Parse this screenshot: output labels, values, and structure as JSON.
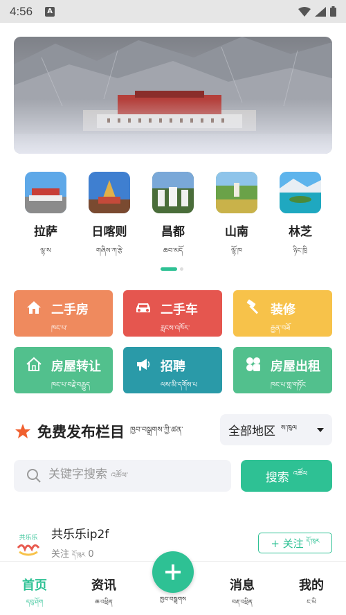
{
  "status_bar": {
    "time": "4:56",
    "notif_letter": "A"
  },
  "banner": {
    "subject": "Potala Palace"
  },
  "cities": [
    {
      "name": "拉萨",
      "tib": "ལྷ་ས"
    },
    {
      "name": "日喀则",
      "tib": "གཞིས་ཀ་རྩེ"
    },
    {
      "name": "昌都",
      "tib": "ཆབ་མདོ"
    },
    {
      "name": "山南",
      "tib": "ལྷོ་ཁ"
    },
    {
      "name": "林芝",
      "tib": "ཉིང་ཁྲི"
    }
  ],
  "categories": [
    {
      "label": "二手房",
      "tib": "ཁང་པ་",
      "color": "#ef8a5e",
      "icon": "house-icon"
    },
    {
      "label": "二手车",
      "tib": "རླངས་འཁོར་",
      "color": "#e5564f",
      "icon": "car-icon"
    },
    {
      "label": "装修",
      "tib": "རྒྱན་བཟོ",
      "color": "#f7c24a",
      "icon": "hammer-icon"
    },
    {
      "label": "房屋转让",
      "tib": "ཁང་པ་བརྗེ་བརྒྱུད",
      "color": "#52c08d",
      "icon": "home-outline-icon"
    },
    {
      "label": "招聘",
      "tib": "ལས་མི་དགོས་པ",
      "color": "#2a9aa8",
      "icon": "megaphone-icon"
    },
    {
      "label": "房屋出租",
      "tib": "ཁང་པ་གླ་གཏོང",
      "color": "#52c08d",
      "icon": "grid-icon"
    }
  ],
  "section": {
    "title": "免费发布栏目",
    "tib": "ཁྱབ་བསྒྲགས་ཀྱི་ཚན་"
  },
  "region": {
    "label": "全部地区",
    "tib": "ས་ཁུལ"
  },
  "search": {
    "placeholder": "关键字搜索",
    "placeholder_tib": "འཚོལ་",
    "button": "搜索",
    "button_tib": "འཚོལ"
  },
  "post": {
    "logo_text": "共乐乐",
    "user": "共乐乐ip2f",
    "meta_label": "关注",
    "meta_tib": "དོ་ཁུར",
    "meta_count": "0",
    "follow": "+ 关注",
    "follow_tib": "དོ་ཁུར"
  },
  "tabbar": {
    "items": [
      {
        "label": "首页",
        "tib": "དབུ་ཤོག"
      },
      {
        "label": "资讯",
        "tib": "ཆ་འཕྲིན"
      },
      {
        "label": "消息",
        "tib": "བརྡ་འཕྲིན"
      },
      {
        "label": "我的",
        "tib": "ང་ཡི"
      }
    ],
    "fab_tib": "ཁྱབ་བསྒྲགས"
  },
  "colors": {
    "accent": "#2ec194"
  }
}
